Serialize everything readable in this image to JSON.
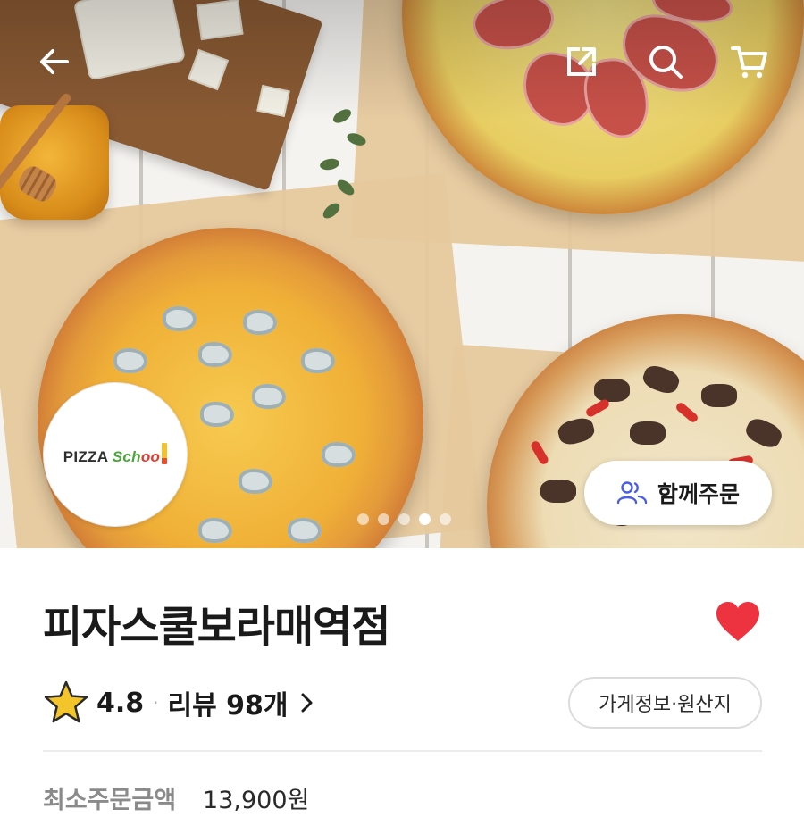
{
  "hero": {
    "carousel": {
      "count": 5,
      "active_index": 3
    },
    "logo": {
      "brand_word": "PIZZA",
      "school_prefix": "Sch",
      "school_oo": "oo"
    },
    "group_order_label": "함께주문"
  },
  "store": {
    "name": "피자스쿨보라매역점",
    "rating": "4.8",
    "rating_separator": "·",
    "reviews_label": "리뷰 98개",
    "info_button": "가게정보·원산지",
    "favorited": true
  },
  "order": {
    "min_order_label": "최소주문금액",
    "min_order_value": "13,900원"
  },
  "icons": {
    "back": "back-arrow-icon",
    "share": "share-icon",
    "search": "search-icon",
    "cart": "cart-icon",
    "favorite": "heart-icon",
    "rating": "star-icon",
    "group": "people-icon",
    "reviews_chevron": "chevron-right-icon"
  },
  "colors": {
    "heart": "#ee3340",
    "star": "#f4c52b",
    "group_icon": "#4b5de4",
    "logo_green": "#4aa63a",
    "logo_red": "#e53a30"
  }
}
